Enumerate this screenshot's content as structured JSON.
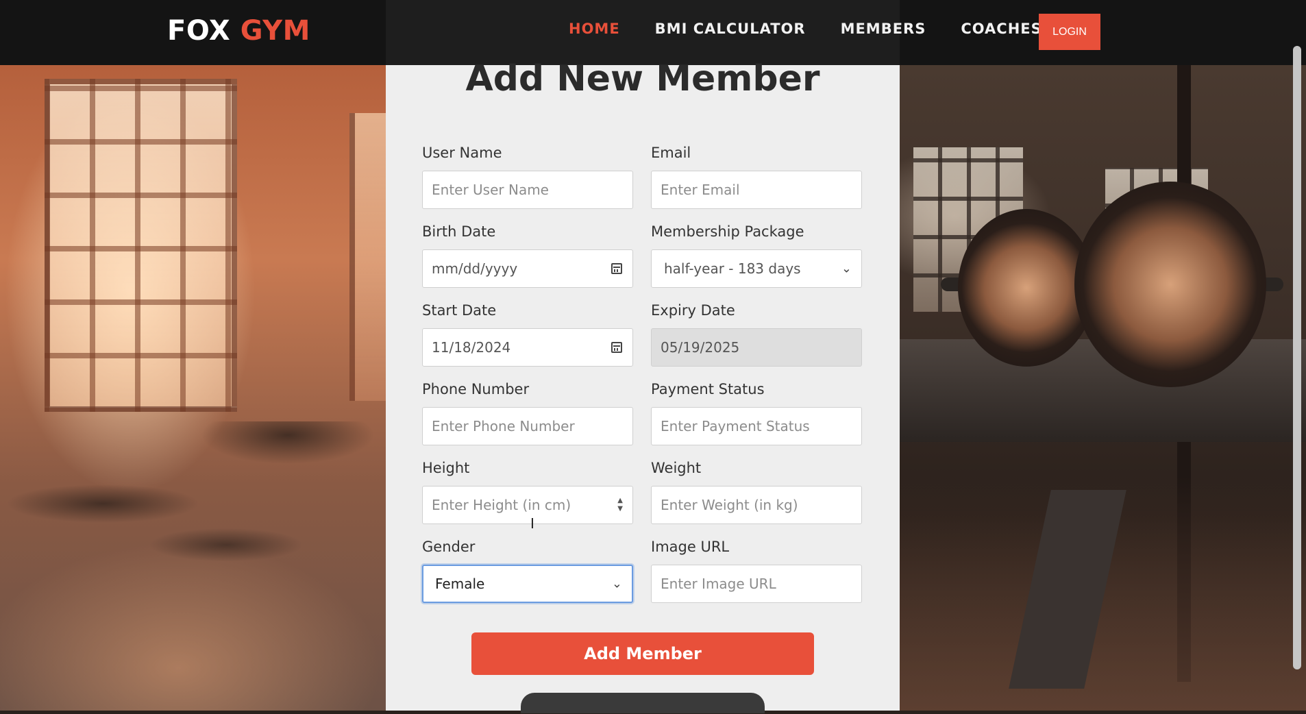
{
  "brand": {
    "part1": "FOX",
    "part2": "GYM"
  },
  "nav": {
    "links": [
      {
        "label": "HOME",
        "active": true
      },
      {
        "label": "BMI CALCULATOR",
        "active": false
      },
      {
        "label": "MEMBERS",
        "active": false
      },
      {
        "label": "COACHES",
        "active": false
      }
    ],
    "login_label": "LOGIN"
  },
  "form": {
    "title": "Add New Member",
    "fields": {
      "user_name": {
        "label": "User Name",
        "placeholder": "Enter User Name"
      },
      "email": {
        "label": "Email",
        "placeholder": "Enter Email"
      },
      "birth_date": {
        "label": "Birth Date",
        "value": "mm/dd/yyyy"
      },
      "membership_package": {
        "label": "Membership Package",
        "value": "half-year - 183 days"
      },
      "start_date": {
        "label": "Start Date",
        "value": "11/18/2024"
      },
      "expiry_date": {
        "label": "Expiry Date",
        "value": "05/19/2025"
      },
      "phone_number": {
        "label": "Phone Number",
        "placeholder": "Enter Phone Number"
      },
      "payment_status": {
        "label": "Payment Status",
        "placeholder": "Enter Payment Status"
      },
      "height": {
        "label": "Height",
        "placeholder": "Enter Height (in cm)"
      },
      "weight": {
        "label": "Weight",
        "placeholder": "Enter Weight (in kg)"
      },
      "gender": {
        "label": "Gender",
        "value": "Female"
      },
      "image_url": {
        "label": "Image URL",
        "placeholder": "Enter Image URL"
      }
    },
    "submit_label": "Add Member"
  },
  "icons": {
    "calendar": "calendar-icon",
    "chevron": "chevron-down-icon",
    "spinner": "number-spinner-icon"
  },
  "colors": {
    "accent": "#e8503a",
    "nav_bg": "#141414",
    "panel_bg": "#eeeeee"
  }
}
